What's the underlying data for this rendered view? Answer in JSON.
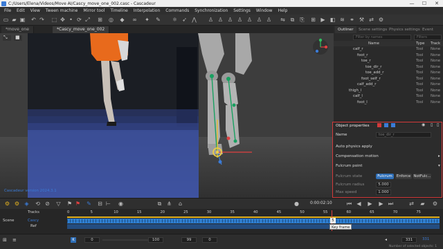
{
  "window": {
    "title": "C:/Users/Elena/Videos/Move AI/Cascy_move_one_002.casc - Cascadeur",
    "minimize": "—",
    "maximize": "☐",
    "close": "✕"
  },
  "menu": [
    "File",
    "Edit",
    "View",
    "Tween machine",
    "Mirror tool",
    "Timeline",
    "Interpolation",
    "Commands",
    "Synchronization",
    "Settings",
    "Window",
    "Help"
  ],
  "doc_tabs": [
    "*move_one",
    "*Cascy_move_one_002"
  ],
  "viewport": {
    "version_label": "Cascadeur version 2024.3.1"
  },
  "side_panel": {
    "tabs": [
      "Outliner",
      "Scene settings",
      "Physics settings",
      "Event tab"
    ],
    "filter_names_placeholder": "Filter by names",
    "filter_types_placeholder": "Filters",
    "columns": [
      "Name",
      "Type",
      "Track"
    ],
    "rows": [
      {
        "name": "calf_r",
        "type": "Tool",
        "track": "None",
        "indent": 1
      },
      {
        "name": "foot_r",
        "type": "Tool",
        "track": "None",
        "indent": 2
      },
      {
        "name": "toe_r",
        "type": "Tool",
        "track": "None",
        "indent": 3
      },
      {
        "name": "toe_dir_r",
        "type": "Tool",
        "track": "None",
        "indent": 4
      },
      {
        "name": "toe_add_r",
        "type": "Tool",
        "track": "None",
        "indent": 4
      },
      {
        "name": "foot_self_r",
        "type": "Tool",
        "track": "None",
        "indent": 3
      },
      {
        "name": "calf_add_r",
        "type": "Tool",
        "track": "None",
        "indent": 2
      },
      {
        "name": "thigh_l",
        "type": "Tool",
        "track": "None",
        "indent": 0
      },
      {
        "name": "calf_l",
        "type": "Tool",
        "track": "None",
        "indent": 1
      },
      {
        "name": "foot_l",
        "type": "Tool",
        "track": "None",
        "indent": 2
      }
    ]
  },
  "object_properties": {
    "title": "Object properties",
    "name_label": "Name",
    "name_value": "toe_dir_r",
    "auto_physics": "Auto physics apply",
    "compensation": "Compensation motion",
    "fulcrum_point": "Fulcrum point",
    "fulcrum_state_label": "Fulcrum state",
    "fulcrum_options": [
      "Fulcrum",
      "Enforce",
      "NotFulc..."
    ],
    "fulcrum_radius_label": "Fulcrum radius",
    "fulcrum_radius": "5.000",
    "max_speed_label": "Max speed",
    "max_speed": "1.000"
  },
  "transport": {
    "timecode": "0:00:02:10",
    "end_frame": "331"
  },
  "timeline": {
    "tracks_label": "Tracks",
    "scene_label": "Scene",
    "track_names": [
      "Cascy",
      "Ref"
    ],
    "ticks": [
      "0",
      "5",
      "10",
      "15",
      "20",
      "25",
      "30",
      "35",
      "40",
      "45",
      "50",
      "55",
      "60",
      "65",
      "70",
      "75"
    ],
    "current_frame": "5",
    "tooltip": "Key frame"
  },
  "bottom": {
    "start": "0",
    "range_start": "100",
    "range_end": "99",
    "current": "0",
    "total": "331",
    "selected_label": "Number of selected objects: 1"
  },
  "colors": {
    "accent": "#3b7bd6",
    "key_blue": "#2f7fd0",
    "highlight_red": "#d23a3a",
    "fulcrum_selected": "#2f6fb8",
    "timeline_yellow": "#e0b020",
    "cursor_red": "#e04040"
  }
}
